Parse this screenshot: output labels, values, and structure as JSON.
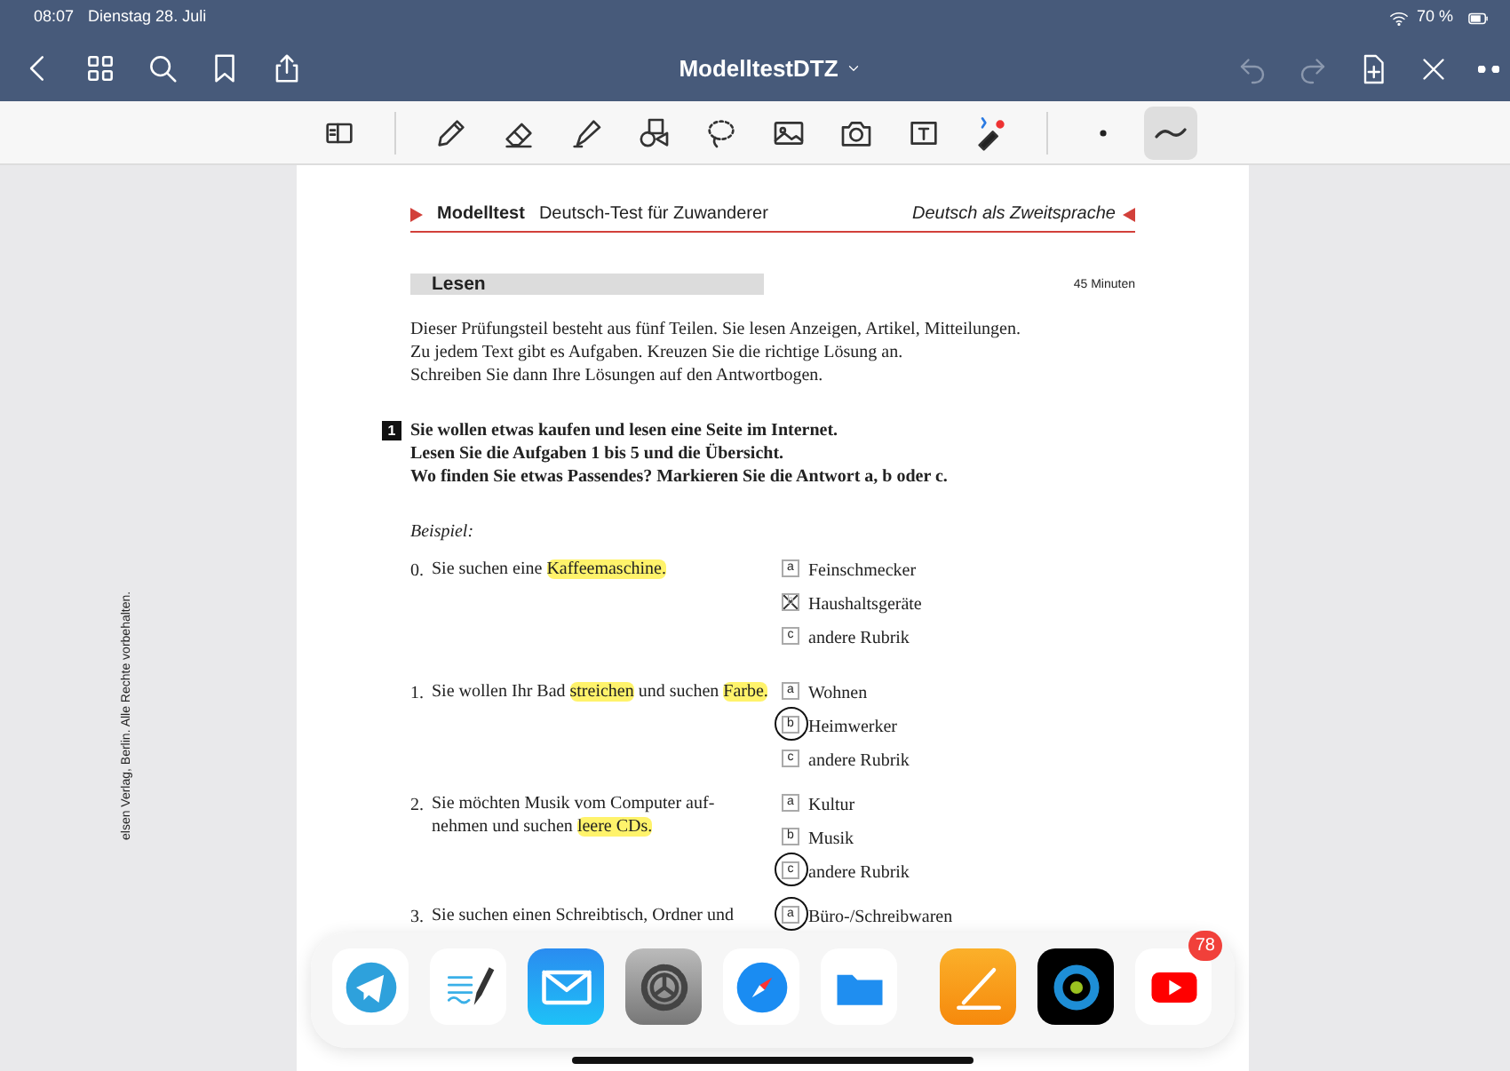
{
  "status_bar": {
    "time": "08:07",
    "date": "Dienstag 28. Juli",
    "battery": "70 %"
  },
  "nav_bar": {
    "title": "ModelltestDTZ",
    "undo_disabled": true,
    "redo_disabled": true
  },
  "tool_groups": [
    [
      {
        "kind": "reader",
        "selected": false
      }
    ],
    [
      {
        "kind": "pen",
        "selected": false
      },
      {
        "kind": "eraser",
        "selected": false
      },
      {
        "kind": "highlighter",
        "selected": false
      },
      {
        "kind": "shapes",
        "selected": false
      },
      {
        "kind": "lasso",
        "selected": false
      },
      {
        "kind": "image",
        "selected": false
      },
      {
        "kind": "camera",
        "selected": false
      },
      {
        "kind": "textbox",
        "selected": false
      },
      {
        "kind": "laser",
        "selected": false
      }
    ],
    [
      {
        "kind": "dot",
        "selected": false
      },
      {
        "kind": "stroke",
        "selected": true
      }
    ]
  ],
  "document": {
    "header": {
      "label": "Modelltest",
      "subtitle": "Deutsch-Test für Zuwanderer",
      "right": "Deutsch als Zweitsprache"
    },
    "section": {
      "title": "Lesen",
      "duration": "45 Minuten"
    },
    "intro": [
      "Dieser Prüfungsteil besteht aus fünf Teilen. Sie lesen Anzeigen, Artikel, Mitteilungen.",
      "Zu jedem Text gibt es Aufgaben. Kreuzen Sie die richtige Lösung an.",
      "Schreiben Sie dann Ihre Lösungen auf den Antwortbogen."
    ],
    "task": {
      "number": "1",
      "lines": [
        "Sie wollen etwas kaufen und lesen eine Seite im Internet.",
        "Lesen Sie die Aufgaben 1 bis 5 und die Übersicht.",
        "Wo finden Sie etwas Passendes? Markieren Sie die Antwort a, b oder c."
      ]
    },
    "example_label": "Beispiel:",
    "questions": [
      {
        "number": "0.",
        "lines": [
          [
            {
              "text": "Sie suchen eine ",
              "highlighted": false
            },
            {
              "text": "Kaffeemaschine.",
              "highlighted": true
            }
          ]
        ],
        "options": [
          {
            "letter": "a",
            "text": "Feinschmecker",
            "crossed": false,
            "circled": false
          },
          {
            "letter": "b",
            "text": "Haushaltsgeräte",
            "crossed": true,
            "circled": false
          },
          {
            "letter": "c",
            "text": "andere Rubrik",
            "crossed": false,
            "circled": false
          }
        ]
      },
      {
        "number": "1.",
        "lines": [
          [
            {
              "text": "Sie wollen Ihr Bad ",
              "highlighted": false
            },
            {
              "text": "streichen",
              "highlighted": true
            },
            {
              "text": " und suchen ",
              "highlighted": false
            },
            {
              "text": "Farbe.",
              "highlighted": true
            }
          ]
        ],
        "options": [
          {
            "letter": "a",
            "text": "Wohnen",
            "crossed": false,
            "circled": false
          },
          {
            "letter": "b",
            "text": "Heimwerker",
            "crossed": false,
            "circled": true
          },
          {
            "letter": "c",
            "text": "andere Rubrik",
            "crossed": false,
            "circled": false
          }
        ]
      },
      {
        "number": "2.",
        "lines": [
          [
            {
              "text": "Sie möchten Musik vom Computer auf-",
              "highlighted": false
            }
          ],
          [
            {
              "text": "nehmen und suchen ",
              "highlighted": false
            },
            {
              "text": "leere CDs.",
              "highlighted": true
            }
          ]
        ],
        "options": [
          {
            "letter": "a",
            "text": "Kultur",
            "crossed": false,
            "circled": false
          },
          {
            "letter": "b",
            "text": "Musik",
            "crossed": false,
            "circled": false
          },
          {
            "letter": "c",
            "text": "andere Rubrik",
            "crossed": false,
            "circled": true
          }
        ]
      },
      {
        "number": "3.",
        "lines": [
          [
            {
              "text": "Sie suchen einen Schreibtisch, Ordner und",
              "highlighted": false
            }
          ]
        ],
        "options": [
          {
            "letter": "a",
            "text": "Büro-/Schreibwaren",
            "crossed": false,
            "circled": true
          }
        ]
      }
    ],
    "copyright": "elsen Verlag, Berlin. Alle Rechte vorbehalten."
  },
  "dock": {
    "apps": [
      {
        "kind": "telegram"
      },
      {
        "kind": "notes"
      },
      {
        "kind": "mail"
      },
      {
        "kind": "settings"
      },
      {
        "kind": "safari"
      },
      {
        "kind": "files"
      },
      {
        "kind": "separator"
      },
      {
        "kind": "pages"
      },
      {
        "kind": "target"
      },
      {
        "kind": "youtube",
        "badge": "78"
      }
    ]
  }
}
